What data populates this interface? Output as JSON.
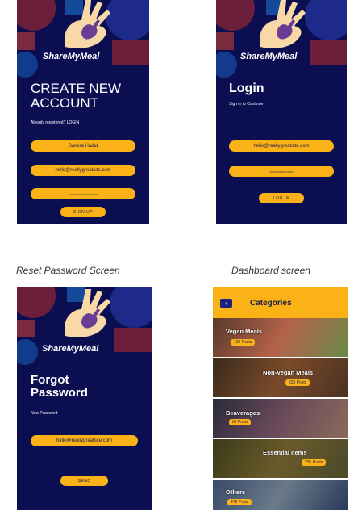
{
  "brand": "ShareMyMeal",
  "screens": {
    "create": {
      "title_line1": "CREATE NEW",
      "title_line2": "ACCOUNT",
      "already": "Already registered? LOGIN",
      "name_value": "Samira Hadid",
      "email_value": "hello@reallygreatsite.com",
      "password_value": "••••••••••••••••••••••••••",
      "submit_label": "SIGN UP"
    },
    "login": {
      "title": "Login",
      "subtitle": "Sign in to Continue",
      "email_value": "hello@reallygreatsite.com",
      "password_value": "•••••••••••••••••••••",
      "submit_label": "LOG IN"
    },
    "reset": {
      "caption": "Reset Password Screen",
      "title_line1": "Forgot",
      "title_line2": "Password",
      "subtitle": "New Password",
      "email_value": "hello@reallygreatsite.com",
      "submit_label": "SEND"
    },
    "dashboard": {
      "caption": "Dashboard screen",
      "title": "Categories",
      "back_icon": "chevron-left-icon",
      "categories": [
        {
          "name": "Vegan Meals",
          "posts": "120 Posts"
        },
        {
          "name": "Non-Vegan Meals",
          "posts": "233 Posts"
        },
        {
          "name": "Beaverages",
          "posts": "89 Posts"
        },
        {
          "name": "Essential Items",
          "posts": "235 Posts"
        },
        {
          "name": "Others",
          "posts": "479 Posts"
        }
      ]
    }
  },
  "colors": {
    "navy": "#0b0f52",
    "accent": "#fbb217",
    "maroon": "#6b1f3a"
  }
}
